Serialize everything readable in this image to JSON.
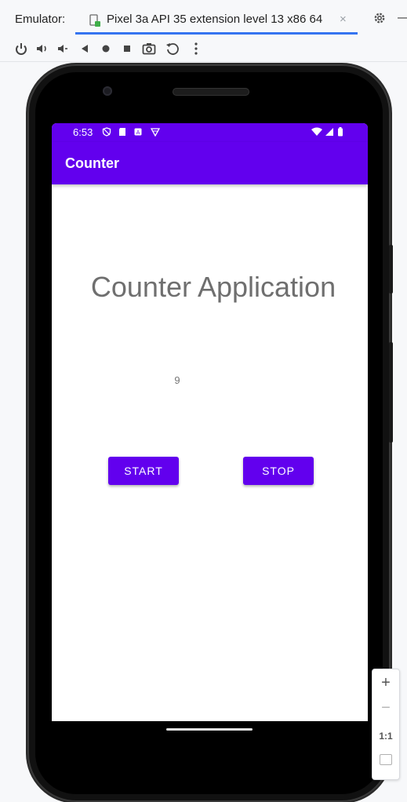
{
  "ide": {
    "panel_label": "Emulator:",
    "tab_title": "Pixel 3a API 35 extension level 13 x86 64",
    "tab_close": "×",
    "minimize": "—"
  },
  "toolbar": {
    "buttons": [
      "power",
      "volume-up",
      "volume-down",
      "back",
      "home",
      "overview",
      "screenshot",
      "rotate",
      "more"
    ]
  },
  "device": {
    "status_time": "6:53",
    "app_title": "Counter",
    "headline": "Counter Application",
    "counter_value": "9",
    "start_label": "START",
    "stop_label": "STOP",
    "accent_color": "#6200ee"
  },
  "zoom": {
    "plus": "+",
    "minus": "−",
    "one_to_one": "1:1"
  }
}
